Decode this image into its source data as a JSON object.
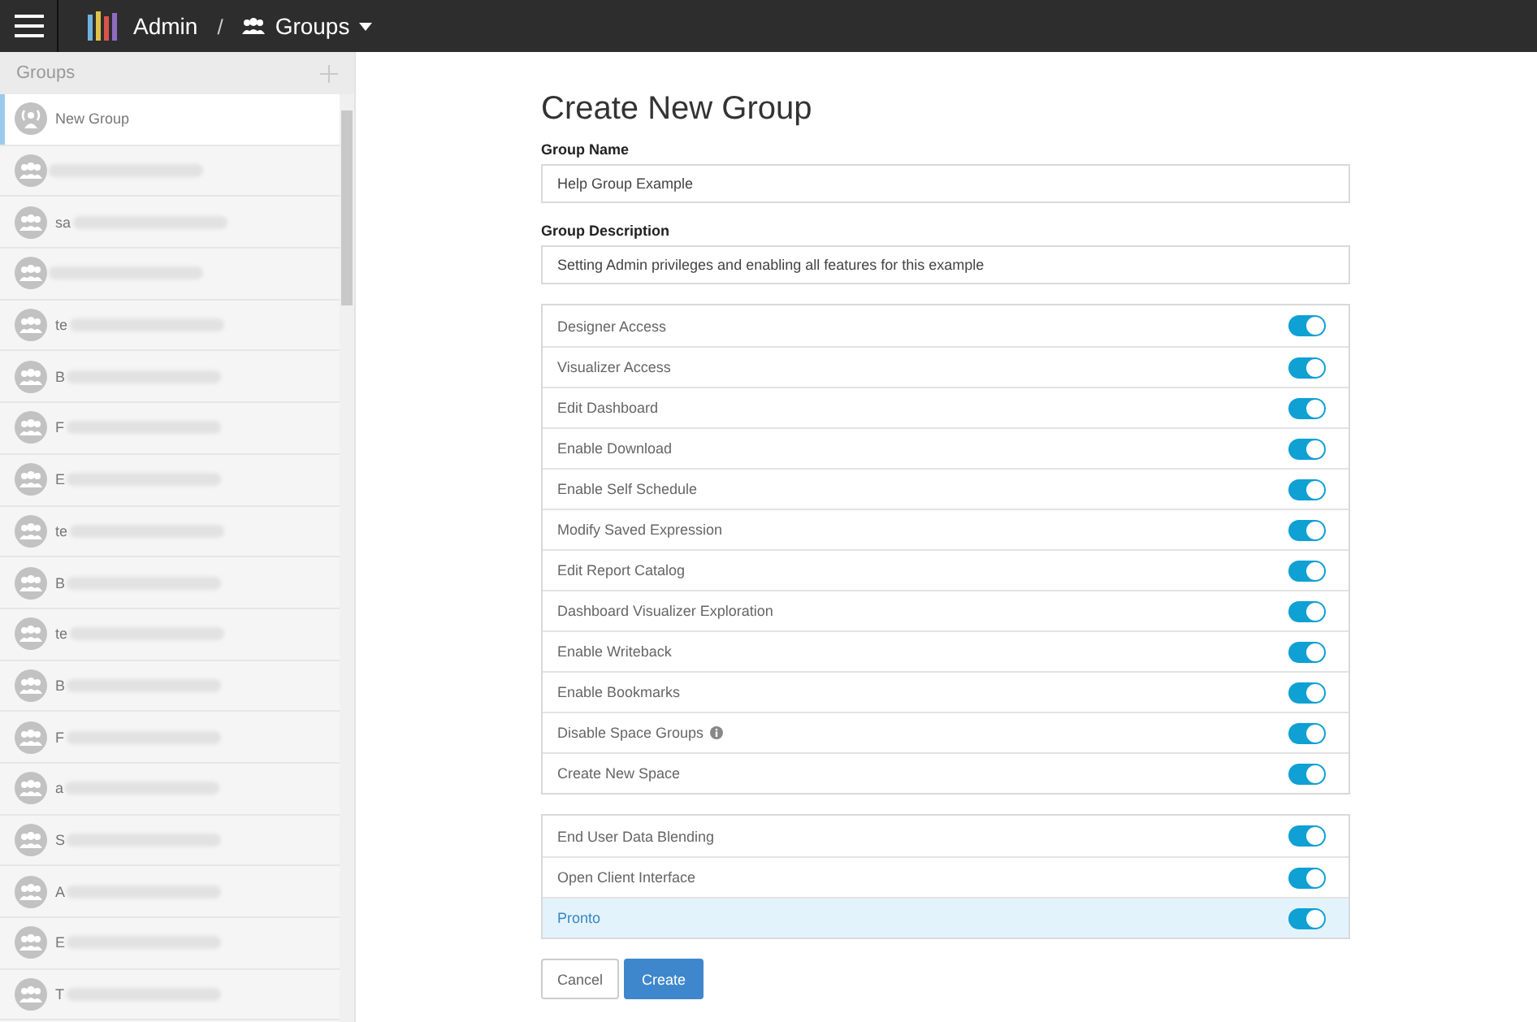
{
  "top_bar": {
    "app": "Admin",
    "separator": "/",
    "section": "Groups"
  },
  "sidebar": {
    "title": "Groups",
    "items": [
      {
        "text": "New Group",
        "kind": "new",
        "selected": true,
        "redacted": false
      },
      {
        "kind": "group",
        "selected": false,
        "redacted": true
      },
      {
        "text": "sa",
        "kind": "group",
        "selected": false,
        "redacted": true
      },
      {
        "kind": "group",
        "selected": false,
        "redacted": true
      },
      {
        "text": "te",
        "kind": "group",
        "selected": false,
        "redacted": true
      },
      {
        "text": "B",
        "kind": "group",
        "selected": false,
        "redacted": true
      },
      {
        "text": "F",
        "kind": "group",
        "selected": false,
        "redacted": true
      },
      {
        "text": "E",
        "kind": "group",
        "selected": false,
        "redacted": true
      },
      {
        "text": "te",
        "kind": "group",
        "selected": false,
        "redacted": true
      },
      {
        "text": "B",
        "kind": "group",
        "selected": false,
        "redacted": true
      },
      {
        "text": "te",
        "kind": "group",
        "selected": false,
        "redacted": true
      },
      {
        "text": "B",
        "kind": "group",
        "selected": false,
        "redacted": true
      },
      {
        "text": "F",
        "kind": "group",
        "selected": false,
        "redacted": true
      },
      {
        "text": "a",
        "kind": "group",
        "selected": false,
        "redacted": true
      },
      {
        "text": "S",
        "kind": "group",
        "selected": false,
        "redacted": true
      },
      {
        "text": "A",
        "kind": "group",
        "selected": false,
        "redacted": true
      },
      {
        "text": "E",
        "kind": "group",
        "selected": false,
        "redacted": true
      },
      {
        "text": "T",
        "kind": "group",
        "selected": false,
        "redacted": true
      }
    ]
  },
  "form": {
    "title": "Create New Group",
    "name_label": "Group Name",
    "name_value": "Help Group Example",
    "description_label": "Group Description",
    "description_value": "Setting Admin privileges and enabling all features for this example",
    "permission_groups": [
      [
        {
          "label": "Designer Access",
          "on": true,
          "selected": false,
          "info": false
        },
        {
          "label": "Visualizer Access",
          "on": true,
          "selected": false,
          "info": false
        },
        {
          "label": "Edit Dashboard",
          "on": true,
          "selected": false,
          "info": false
        },
        {
          "label": "Enable Download",
          "on": true,
          "selected": false,
          "info": false
        },
        {
          "label": "Enable Self Schedule",
          "on": true,
          "selected": false,
          "info": false
        },
        {
          "label": "Modify Saved Expression",
          "on": true,
          "selected": false,
          "info": false
        },
        {
          "label": "Edit Report Catalog",
          "on": true,
          "selected": false,
          "info": false
        },
        {
          "label": "Dashboard Visualizer Exploration",
          "on": true,
          "selected": false,
          "info": false
        },
        {
          "label": "Enable Writeback",
          "on": true,
          "selected": false,
          "info": false
        },
        {
          "label": "Enable Bookmarks",
          "on": true,
          "selected": false,
          "info": false
        },
        {
          "label": "Disable Space Groups",
          "on": true,
          "selected": false,
          "info": true
        },
        {
          "label": "Create New Space",
          "on": true,
          "selected": false,
          "info": false
        }
      ],
      [
        {
          "label": "End User Data Blending",
          "on": true,
          "selected": false,
          "info": false
        },
        {
          "label": "Open Client Interface",
          "on": true,
          "selected": false,
          "info": false
        },
        {
          "label": "Pronto",
          "on": true,
          "selected": true,
          "info": false
        }
      ]
    ],
    "buttons": [
      {
        "label": "Cancel",
        "kind": "secondary"
      },
      {
        "label": "Create",
        "kind": "primary"
      }
    ]
  }
}
